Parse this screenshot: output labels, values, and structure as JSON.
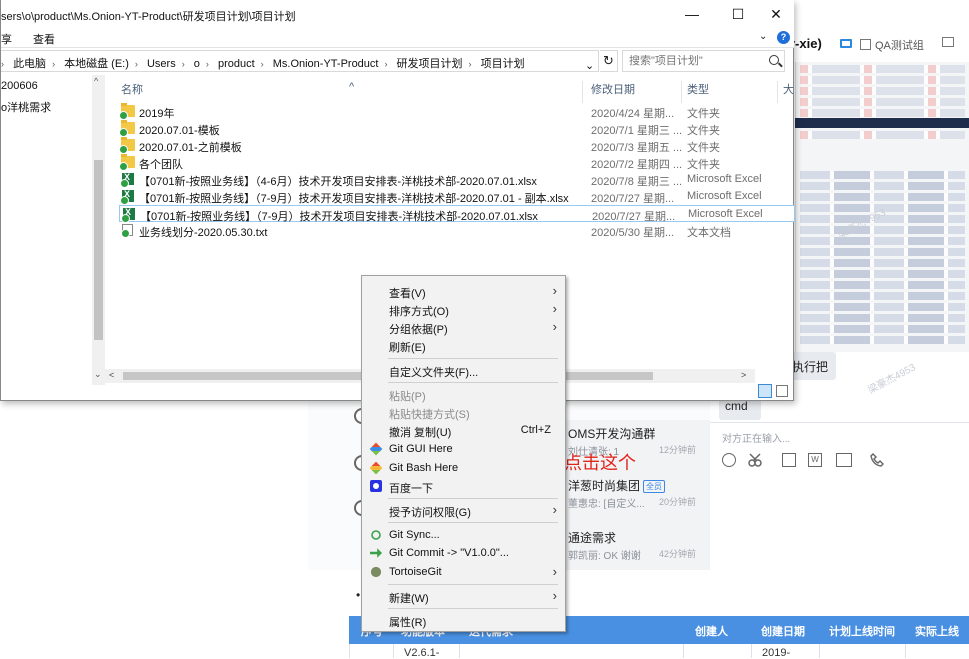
{
  "explorer": {
    "title": "sers\\o\\product\\Ms.Onion-YT-Product\\研发项目计划\\项目计划",
    "window_buttons": [
      "—",
      "☐",
      "✕"
    ],
    "ribbon": {
      "tab_share": "享",
      "tab_view": "查看",
      "expand": "⌄",
      "help": "?"
    },
    "breadcrumb": [
      "此电脑",
      "本地磁盘 (E:)",
      "Users",
      "o",
      "product",
      "Ms.Onion-YT-Product",
      "研发项目计划",
      "项目计划"
    ],
    "search_placeholder": "搜索\"项目计划\"",
    "nav_items": [
      "200606",
      "o洋桃需求"
    ],
    "columns": {
      "name": "名称",
      "date": "修改日期",
      "type": "类型",
      "size": "大"
    },
    "files": [
      {
        "name": "2019年",
        "date": "2020/4/24 星期...",
        "type": "文件夹",
        "icon": "folder"
      },
      {
        "name": "2020.07.01-模板",
        "date": "2020/7/1 星期三 ...",
        "type": "文件夹",
        "icon": "folder"
      },
      {
        "name": "2020.07.01-之前模板",
        "date": "2020/7/3 星期五 ...",
        "type": "文件夹",
        "icon": "folder"
      },
      {
        "name": "各个团队",
        "date": "2020/7/2 星期四 ...",
        "type": "文件夹",
        "icon": "folder"
      },
      {
        "name": "【0701新-按照业务线】（4-6月）技术开发项目安排表-洋桃技术部-2020.07.01.xlsx",
        "date": "2020/7/8 星期三 ...",
        "type": "Microsoft Excel",
        "icon": "xls"
      },
      {
        "name": "【0701新-按照业务线】（7-9月）技术开发项目安排表-洋桃技术部-2020.07.01 - 副本.xlsx",
        "date": "2020/7/27 星期...",
        "type": "Microsoft Excel",
        "icon": "xls"
      },
      {
        "name": "【0701新-按照业务线】（7-9月）技术开发项目安排表-洋桃技术部-2020.07.01.xlsx",
        "date": "2020/7/27 星期...",
        "type": "Microsoft Excel",
        "icon": "xls"
      },
      {
        "name": "业务线划分-2020.05.30.txt",
        "date": "2020/5/30 星期...",
        "type": "文本文档",
        "icon": "txt"
      }
    ]
  },
  "context_menu": {
    "view": "查看(V)",
    "sort": "排序方式(O)",
    "group": "分组依据(P)",
    "refresh": "刷新(E)",
    "customize": "自定义文件夹(F)...",
    "paste": "粘贴(P)",
    "paste_shortcut": "粘贴快捷方式(S)",
    "undo_copy": "撤消 复制(U)",
    "undo_shortcut": "Ctrl+Z",
    "git_gui": "Git GUI Here",
    "git_bash": "Git Bash Here",
    "baidu": "百度一下",
    "grant_access": "授予访问权限(G)",
    "git_sync": "Git Sync...",
    "git_commit": "Git Commit -> \"V1.0.0\"...",
    "tortoise": "TortoiseGit",
    "new": "新建(W)",
    "properties": "属性(R)"
  },
  "annotation": {
    "text": "右键点击这个",
    "color": "#e2231a"
  },
  "chat": {
    "header_name": "r-xie)",
    "header_group": "QA测试组",
    "bubble_exec": "执行把",
    "bubble_cmd": "cmd",
    "typing": "对方正在输入...",
    "watermark": "梁豪杰4953",
    "conversations": [
      {
        "title": "OMS开发沟通群",
        "sub": "刘仕清张: 1",
        "time": "12分钟前",
        "badge": ""
      },
      {
        "title": "洋葱时尚集团",
        "sub": "董惠忠: [自定义...",
        "time": "20分钟前",
        "badge": "全员"
      },
      {
        "title": "通途需求",
        "sub": "郭凯丽: OK 谢谢",
        "time": "42分钟前",
        "badge": ""
      }
    ]
  },
  "doc_table": {
    "headers": [
      "序号",
      "功能版本",
      "迭代需求",
      "创建人",
      "创建日期",
      "计划上线时间",
      "实际上线"
    ],
    "row": [
      "",
      "V2.6.1-",
      "",
      "",
      "2019-",
      "",
      ""
    ]
  }
}
